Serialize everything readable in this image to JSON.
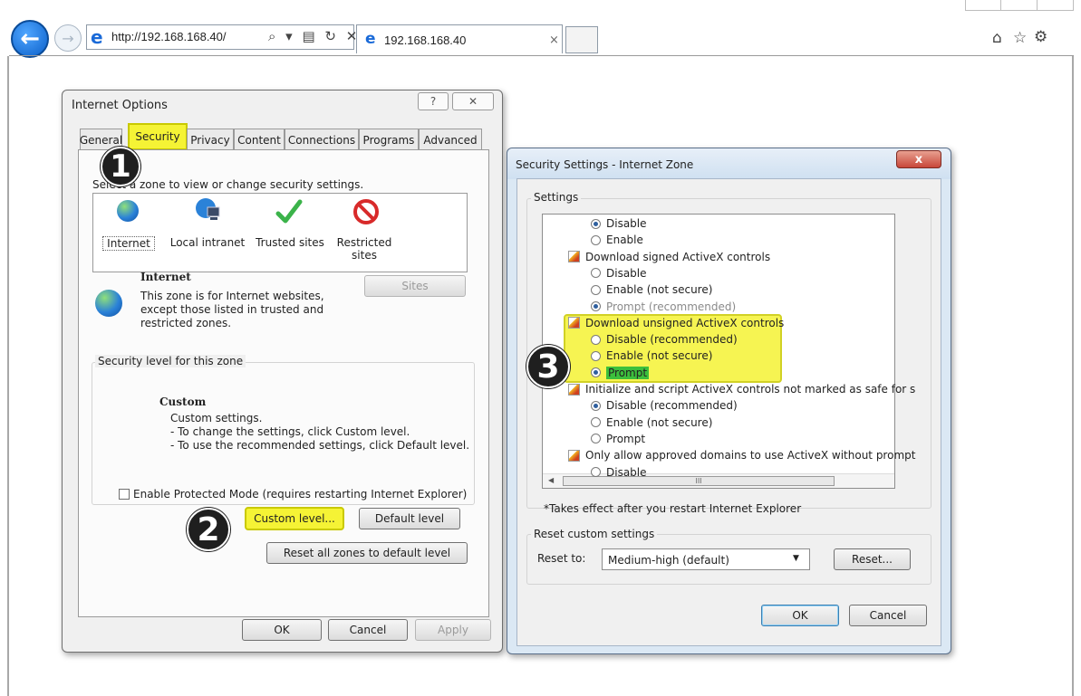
{
  "browser": {
    "url": "http://192.168.168.40/",
    "address_icons": "⌕ ▾ ▤ ↻ ✕",
    "tab_title": "192.168.168.40",
    "tab_close": "×",
    "back_glyph": "←",
    "forward_glyph": "→",
    "home_glyph": "⌂",
    "star_glyph": "☆",
    "gear_glyph": "⚙"
  },
  "internet_options": {
    "title": "Internet Options",
    "help": "?",
    "close": "✕",
    "tabs": [
      "General",
      "Security",
      "Privacy",
      "Content",
      "Connections",
      "Programs",
      "Advanced"
    ],
    "selected_tab": "Security",
    "select_zone_text": "Select a zone to view or change security settings.",
    "zones": [
      "Internet",
      "Local intranet",
      "Trusted sites",
      "Restricted sites"
    ],
    "zone_heading": "Internet",
    "zone_desc": [
      "This zone is for Internet websites,",
      "except those listed in trusted and",
      "restricted zones."
    ],
    "sites_button": "Sites",
    "security_level_group": "Security level for this zone",
    "level_name": "Custom",
    "level_desc": [
      "Custom settings.",
      "- To change the settings, click Custom level.",
      "- To use the recommended settings, click Default level."
    ],
    "protected_mode_label": "Enable Protected Mode (requires restarting Internet Explorer)",
    "custom_level_button": "Custom level...",
    "default_level_button": "Default level",
    "reset_all_button": "Reset all zones to default level",
    "ok": "OK",
    "cancel": "Cancel",
    "apply": "Apply"
  },
  "security_settings": {
    "title": "Security Settings - Internet Zone",
    "close": "x",
    "settings_group": "Settings",
    "list": [
      {
        "kind": "radio",
        "label": "Disable",
        "checked": true
      },
      {
        "kind": "radio",
        "label": "Enable",
        "checked": false
      },
      {
        "kind": "header",
        "label": "Download signed ActiveX controls"
      },
      {
        "kind": "radio",
        "label": "Disable",
        "checked": false
      },
      {
        "kind": "radio",
        "label": "Enable (not secure)",
        "checked": false
      },
      {
        "kind": "radio",
        "label": "Prompt (recommended)",
        "checked": true
      },
      {
        "kind": "header",
        "label": "Download unsigned ActiveX controls"
      },
      {
        "kind": "radio",
        "label": "Disable (recommended)",
        "checked": false
      },
      {
        "kind": "radio",
        "label": "Enable (not secure)",
        "checked": false
      },
      {
        "kind": "radio",
        "label": "Prompt",
        "checked": true
      },
      {
        "kind": "header",
        "label": "Initialize and script ActiveX controls not marked as safe for s"
      },
      {
        "kind": "radio",
        "label": "Disable (recommended)",
        "checked": true
      },
      {
        "kind": "radio",
        "label": "Enable (not secure)",
        "checked": false
      },
      {
        "kind": "radio",
        "label": "Prompt",
        "checked": false
      },
      {
        "kind": "header",
        "label": "Only allow approved domains to use ActiveX without prompt"
      },
      {
        "kind": "radio",
        "label": "Disable",
        "checked": false
      }
    ],
    "scroll_mid": "III",
    "restart_note": "*Takes effect after you restart Internet Explorer",
    "reset_group": "Reset custom settings",
    "reset_to_label": "Reset to:",
    "reset_to_value": "Medium-high (default)",
    "reset_button": "Reset...",
    "ok": "OK",
    "cancel": "Cancel"
  },
  "steps": [
    "1",
    "2",
    "3"
  ],
  "colors": {
    "highlight": "#f5f335",
    "step_badge": "#1f1f1f",
    "accent_blue": "#1a6ad8"
  }
}
